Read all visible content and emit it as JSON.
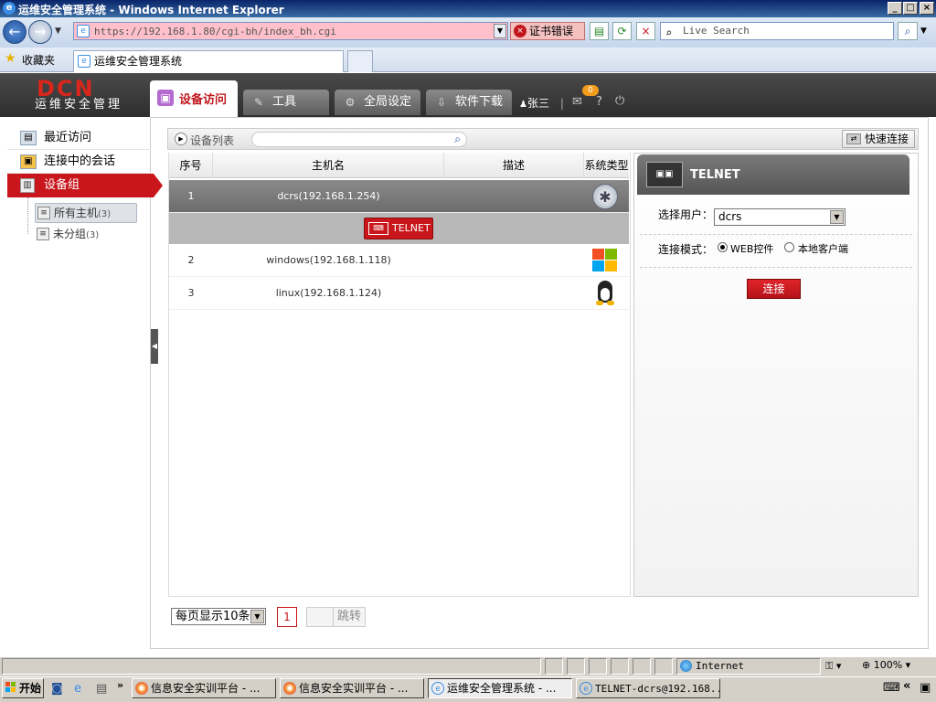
{
  "window": {
    "title": "运维安全管理系统 - Windows Internet Explorer"
  },
  "browser": {
    "url": "https://192.168.1.80/cgi-bh/index_bh.cgi",
    "cert_error": "证书错误",
    "search_placeholder": "Live Search",
    "favorites_label": "收藏夹",
    "tab_title": "运维安全管理系统"
  },
  "app": {
    "logo_main": "DCN",
    "logo_sub": "运维安全管理",
    "nav": [
      {
        "label": "设备访问"
      },
      {
        "label": "工具"
      },
      {
        "label": "全局设定"
      },
      {
        "label": "软件下载"
      }
    ],
    "user": "张三",
    "badge_count": "0",
    "help": "?"
  },
  "sidebar": {
    "recent": "最近访问",
    "sessions": "连接中的会话",
    "groups": "设备组",
    "tree": [
      {
        "label": "所有主机",
        "count": "(3)"
      },
      {
        "label": "未分组",
        "count": "(3)"
      }
    ]
  },
  "list": {
    "title": "设备列表",
    "quick_connect": "快速连接",
    "columns": [
      "序号",
      "主机名",
      "描述",
      "系统类型"
    ],
    "rows": [
      {
        "no": "1",
        "host": "dcrs(192.168.1.254)",
        "desc": "",
        "os": "network-os-icon"
      },
      {
        "no": "2",
        "host": "windows(192.168.1.118)",
        "desc": "",
        "os": "windows-icon"
      },
      {
        "no": "3",
        "host": "linux(192.168.1.124)",
        "desc": "",
        "os": "linux-icon"
      }
    ],
    "protocol_button": "TELNET"
  },
  "panel": {
    "protocol": "TELNET",
    "user_label": "选择用户：",
    "user_value": "dcrs",
    "mode_label": "连接模式：",
    "mode_options": [
      "WEB控件",
      "本地客户端"
    ],
    "mode_selected": "WEB控件",
    "connect_button": "连接"
  },
  "pager": {
    "page_size": "每页显示10条",
    "current": "1",
    "jump": "跳转"
  },
  "statusbar": {
    "zone": "Internet",
    "zoom": "100%"
  },
  "taskbar": {
    "start": "开始",
    "tasks": [
      "信息安全实训平台 - ...",
      "信息安全实训平台 - ...",
      "运维安全管理系统 - ...",
      "TELNET-dcrs@192.168..."
    ]
  },
  "colors": {
    "accent": "#c8161c",
    "header_bg": "#3a3a3a",
    "ie_frame": "#d4d0c8"
  }
}
